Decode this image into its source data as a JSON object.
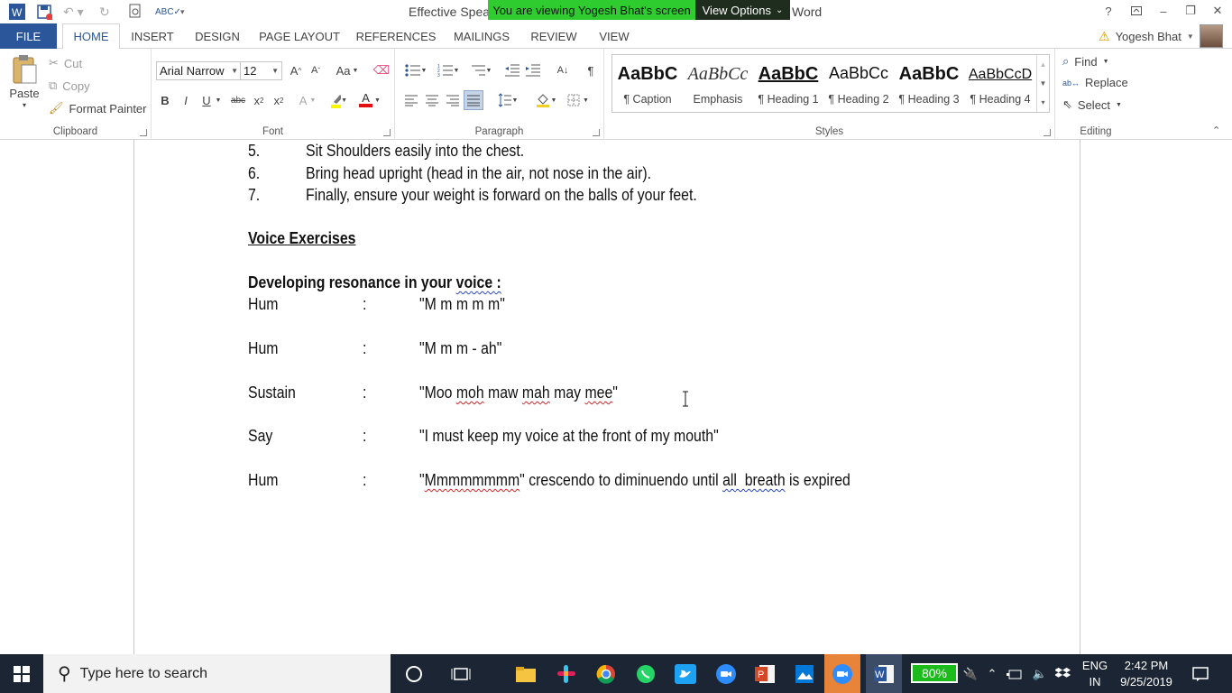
{
  "titlebar": {
    "doc_title_start": "Effective Speak",
    "doc_title_end": "Word",
    "share_banner": "You are viewing Yogesh Bhat's screen",
    "view_options": "View Options",
    "help": "?",
    "minimize": "–",
    "restore": "❐",
    "close": "✕"
  },
  "tabs": {
    "file": "FILE",
    "items": [
      "HOME",
      "INSERT",
      "DESIGN",
      "PAGE LAYOUT",
      "REFERENCES",
      "MAILINGS",
      "REVIEW",
      "VIEW"
    ],
    "user_name": "Yogesh Bhat"
  },
  "ribbon": {
    "clipboard": {
      "label": "Clipboard",
      "paste": "Paste",
      "cut": "Cut",
      "copy": "Copy",
      "format_painter": "Format Painter"
    },
    "font": {
      "label": "Font",
      "font_name": "Arial Narrow",
      "font_size": "12",
      "grow": "A",
      "shrink": "A",
      "change_case": "Aa",
      "bold": "B",
      "italic": "I",
      "underline": "U",
      "strike": "abc",
      "subscript": "x",
      "superscript": "x",
      "text_effects": "A",
      "font_color": "A"
    },
    "paragraph": {
      "label": "Paragraph"
    },
    "styles": {
      "label": "Styles",
      "items": [
        {
          "preview": "AaBbC",
          "name": "¶ Caption"
        },
        {
          "preview": "AaBbCc",
          "name": "Emphasis"
        },
        {
          "preview": "AaBbC",
          "name": "¶ Heading 1"
        },
        {
          "preview": "AaBbCc",
          "name": "¶ Heading 2"
        },
        {
          "preview": "AaBbC",
          "name": "¶ Heading 3"
        },
        {
          "preview": "AaBbCcD",
          "name": "¶ Heading 4"
        }
      ]
    },
    "editing": {
      "label": "Editing",
      "find": "Find",
      "replace": "Replace",
      "select": "Select"
    }
  },
  "document": {
    "numbered": [
      {
        "num": "5.",
        "text": "Sit Shoulders easily into the chest."
      },
      {
        "num": "6.",
        "text": "Bring head upright (head in the air, not nose in the air)."
      },
      {
        "num": "7.",
        "text": "Finally, ensure your weight is forward on the balls of your feet."
      }
    ],
    "heading": "Voice Exercises",
    "subheading_start": "Developing resonance in your ",
    "subheading_word": "voice :",
    "exercises": [
      {
        "verb": "Hum",
        "colon": ":",
        "text": "\"M m m m m\""
      },
      {
        "verb": "Hum",
        "colon": ":",
        "text": "\"M m m - ah\""
      },
      {
        "verb": "Sustain",
        "colon": ":",
        "text_parts": [
          "\"Moo ",
          "moh",
          " maw ",
          "mah",
          " may ",
          "mee",
          "\""
        ]
      },
      {
        "verb": "Say",
        "colon": ":",
        "text": "\"I must keep my voice at the front of my mouth\""
      },
      {
        "verb": "Hum",
        "colon": ":",
        "text_parts": [
          "\"",
          "Mmmmmmmm",
          "\" crescendo to diminuendo until ",
          "all  breath",
          " is expired"
        ]
      }
    ]
  },
  "taskbar": {
    "search_placeholder": "Type here to search",
    "battery": "80%",
    "lang_1": "ENG",
    "lang_2": "IN",
    "time": "2:42 PM",
    "date": "9/25/2019"
  }
}
